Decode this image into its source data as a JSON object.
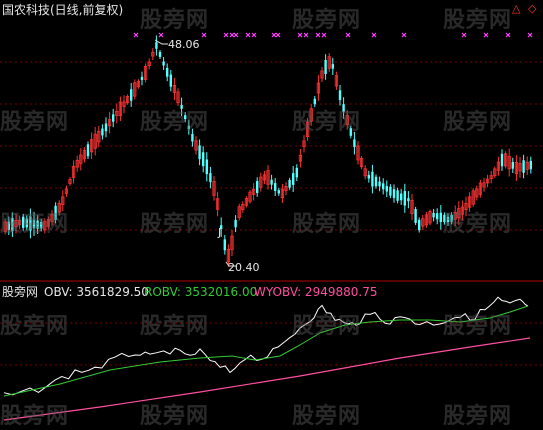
{
  "header": {
    "title": "国农科技(日线,前复权)",
    "controls": [
      "△",
      "◇"
    ]
  },
  "lower_panel": {
    "name": "股旁网",
    "obv": "OBV: 3561829.50",
    "robv": "ROBV: 3532016.00",
    "wyobv": "WYOBV: 2949880.75"
  },
  "annotations": {
    "high": "48.06",
    "low": "20.40",
    "low_marker": "J"
  },
  "watermark": "股旁网",
  "colors": {
    "up": "#ff3333",
    "down": "#54ffff",
    "grid": "#7a0000",
    "obv": "#ffffff",
    "robv": "#33cc33",
    "wyobv": "#ff4fa0",
    "signal": "#ff44ff"
  }
}
